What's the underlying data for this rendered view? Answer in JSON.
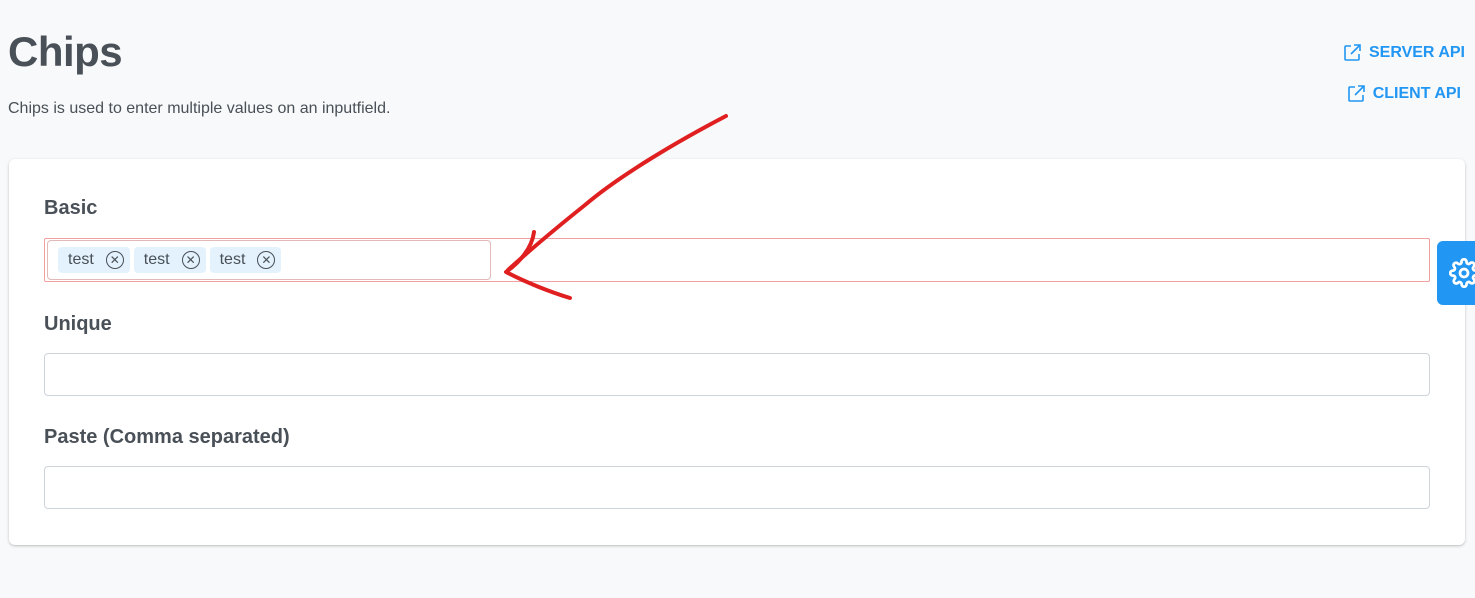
{
  "header": {
    "title": "Chips",
    "description": "Chips is used to enter multiple values on an inputfield."
  },
  "links": {
    "server_api": "SERVER API",
    "client_api": "CLIENT API",
    "icon": "external-link-icon"
  },
  "sections": {
    "basic": {
      "label": "Basic",
      "chips": [
        "test",
        "test",
        "test"
      ]
    },
    "unique": {
      "label": "Unique",
      "value": ""
    },
    "paste": {
      "label": "Paste (Comma separated)",
      "value": ""
    }
  },
  "config_button": {
    "icon": "gear-icon"
  },
  "colors": {
    "accent": "#2196f3",
    "chip_bg": "#e3f2fd",
    "annotation": "#e02020"
  }
}
